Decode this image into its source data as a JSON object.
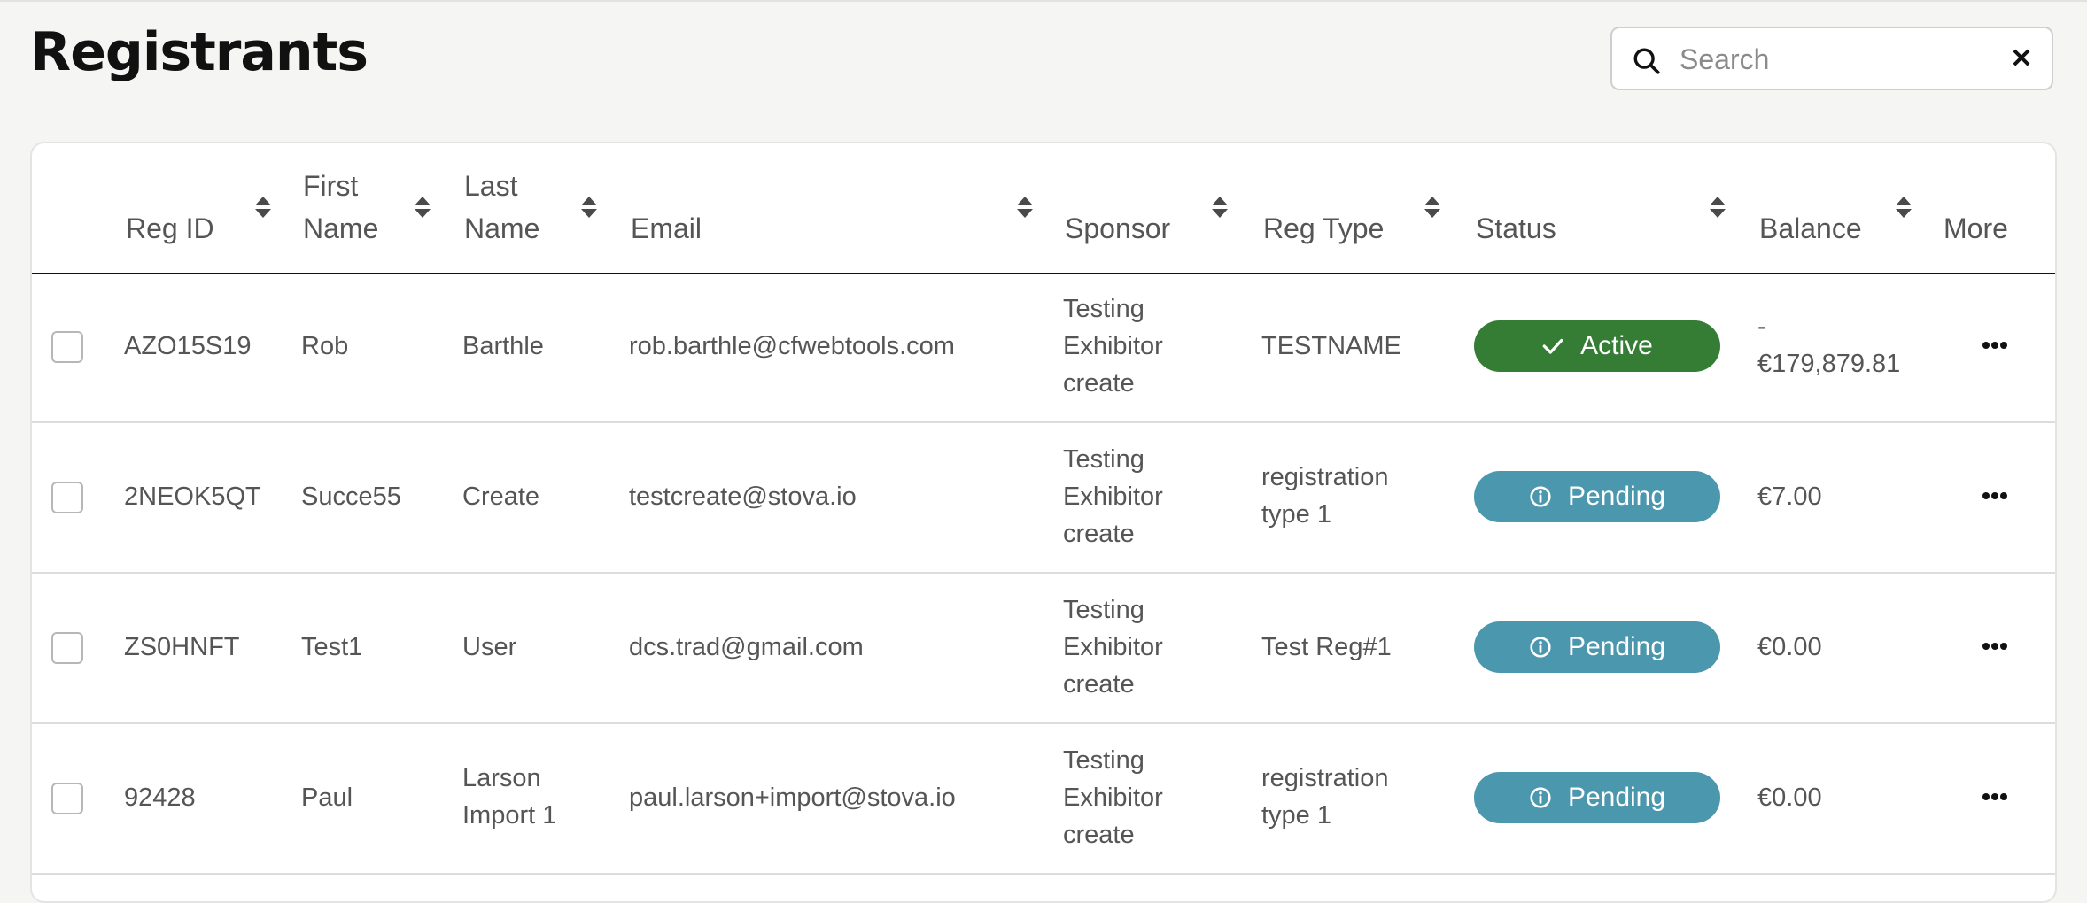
{
  "page": {
    "title": "Registrants"
  },
  "search": {
    "placeholder": "Search",
    "value": ""
  },
  "table": {
    "columns": {
      "reg_id": "Reg ID",
      "first_name": [
        "First",
        "Name"
      ],
      "last_name": [
        "Last",
        "Name"
      ],
      "email": "Email",
      "sponsor": "Sponsor",
      "reg_type": "Reg Type",
      "status": "Status",
      "balance": "Balance",
      "more": "More"
    },
    "rows": [
      {
        "reg_id": "AZO15S19",
        "first_name": "Rob",
        "last_name": [
          "Barthle"
        ],
        "email": "rob.barthle@cfwebtools.com",
        "sponsor": [
          "Testing",
          "Exhibitor",
          "create"
        ],
        "reg_type": [
          "TESTNAME"
        ],
        "status": "Active",
        "status_kind": "active",
        "balance": [
          "-",
          "€179,879.81"
        ]
      },
      {
        "reg_id": "2NEOK5QT",
        "first_name": "Succe55",
        "last_name": [
          "Create"
        ],
        "email": "testcreate@stova.io",
        "sponsor": [
          "Testing",
          "Exhibitor",
          "create"
        ],
        "reg_type": [
          "registration",
          "type 1"
        ],
        "status": "Pending",
        "status_kind": "pending",
        "balance": [
          "€7.00"
        ]
      },
      {
        "reg_id": "ZS0HNFT",
        "first_name": "Test1",
        "last_name": [
          "User"
        ],
        "email": "dcs.trad@gmail.com",
        "sponsor": [
          "Testing",
          "Exhibitor",
          "create"
        ],
        "reg_type": [
          "Test Reg#1"
        ],
        "status": "Pending",
        "status_kind": "pending",
        "balance": [
          "€0.00"
        ]
      },
      {
        "reg_id": "92428",
        "first_name": "Paul",
        "last_name": [
          "Larson",
          "Import 1"
        ],
        "email": "paul.larson+import@stova.io",
        "sponsor": [
          "Testing",
          "Exhibitor",
          "create"
        ],
        "reg_type": [
          "registration",
          "type 1"
        ],
        "status": "Pending",
        "status_kind": "pending",
        "balance": [
          "€0.00"
        ]
      }
    ]
  },
  "colors": {
    "active": "#357d34",
    "pending": "#4b97ae",
    "header_rule": "#111111"
  }
}
